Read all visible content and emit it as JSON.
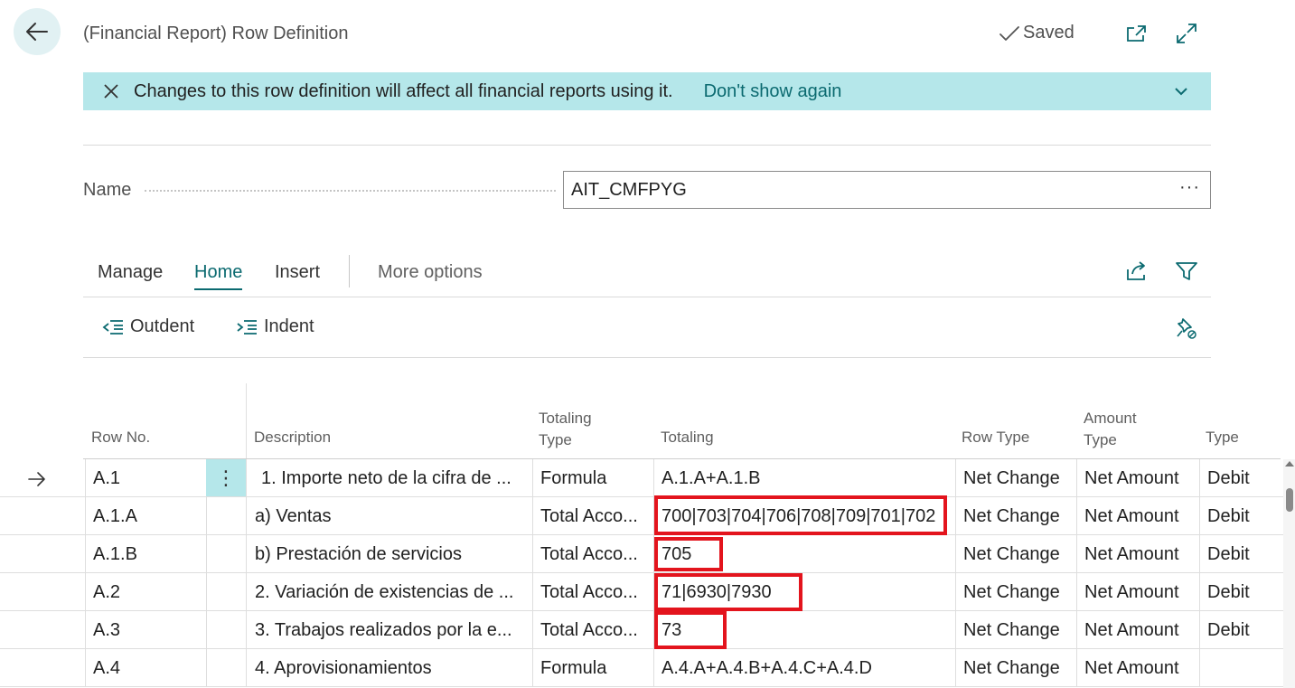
{
  "header": {
    "title": "(Financial Report) Row Definition",
    "saved_label": "Saved",
    "icons": [
      "back-arrow-icon",
      "check-icon",
      "open-new-window-icon",
      "expand-icon"
    ]
  },
  "banner": {
    "message": "Changes to this row definition will affect all financial reports using it.",
    "dont_show_label": "Don't show again",
    "color": "#b5e7ea"
  },
  "name_field": {
    "label": "Name",
    "value": "AIT_CMFPYG",
    "more_label": "···"
  },
  "tabs": {
    "manage": "Manage",
    "home": "Home",
    "insert": "Insert",
    "more": "More options",
    "active": "Home"
  },
  "actions": {
    "outdent": "Outdent",
    "indent": "Indent"
  },
  "grid": {
    "headers": {
      "row_no": "Row No.",
      "description": "Description",
      "totaling_type_line1": "Totaling",
      "totaling_type_line2": "Type",
      "totaling": "Totaling",
      "row_type": "Row Type",
      "amount_type_line1": "Amount",
      "amount_type_line2": "Type",
      "type": "Type"
    },
    "rows": [
      {
        "row_no": "A.1",
        "description": "1. Importe neto de la cifra de ...",
        "totaling_type": "Formula",
        "totaling": "A.1.A+A.1.B",
        "row_type": "Net Change",
        "amount_type": "Net Amount",
        "type": "Debit"
      },
      {
        "row_no": "A.1.A",
        "description": "a) Ventas",
        "totaling_type": "Total Acco...",
        "totaling": "700|703|704|706|708|709|701|702",
        "row_type": "Net Change",
        "amount_type": "Net Amount",
        "type": "Debit"
      },
      {
        "row_no": "A.1.B",
        "description": "b) Prestación de servicios",
        "totaling_type": "Total Acco...",
        "totaling": "705",
        "row_type": "Net Change",
        "amount_type": "Net Amount",
        "type": "Debit"
      },
      {
        "row_no": "A.2",
        "description": "2. Variación de existencias de ...",
        "totaling_type": "Total Acco...",
        "totaling": "71|6930|7930",
        "row_type": "Net Change",
        "amount_type": "Net Amount",
        "type": "Debit"
      },
      {
        "row_no": "A.3",
        "description": "3. Trabajos realizados por la e...",
        "totaling_type": "Total Acco...",
        "totaling": "73",
        "row_type": "Net Change",
        "amount_type": "Net Amount",
        "type": "Debit"
      },
      {
        "row_no": "A.4",
        "description": "4. Aprovisionamientos",
        "totaling_type": "Formula",
        "totaling": "A.4.A+A.4.B+A.4.C+A.4.D",
        "row_type": "Net Change",
        "amount_type": "Net Amount",
        "type": ""
      }
    ],
    "row_menu_label": "⋮",
    "highlight_color": "#e3141d"
  },
  "colors": {
    "accent": "#0b6a70",
    "banner": "#b5e7ea",
    "selected_cell": "#b5e7ea"
  }
}
